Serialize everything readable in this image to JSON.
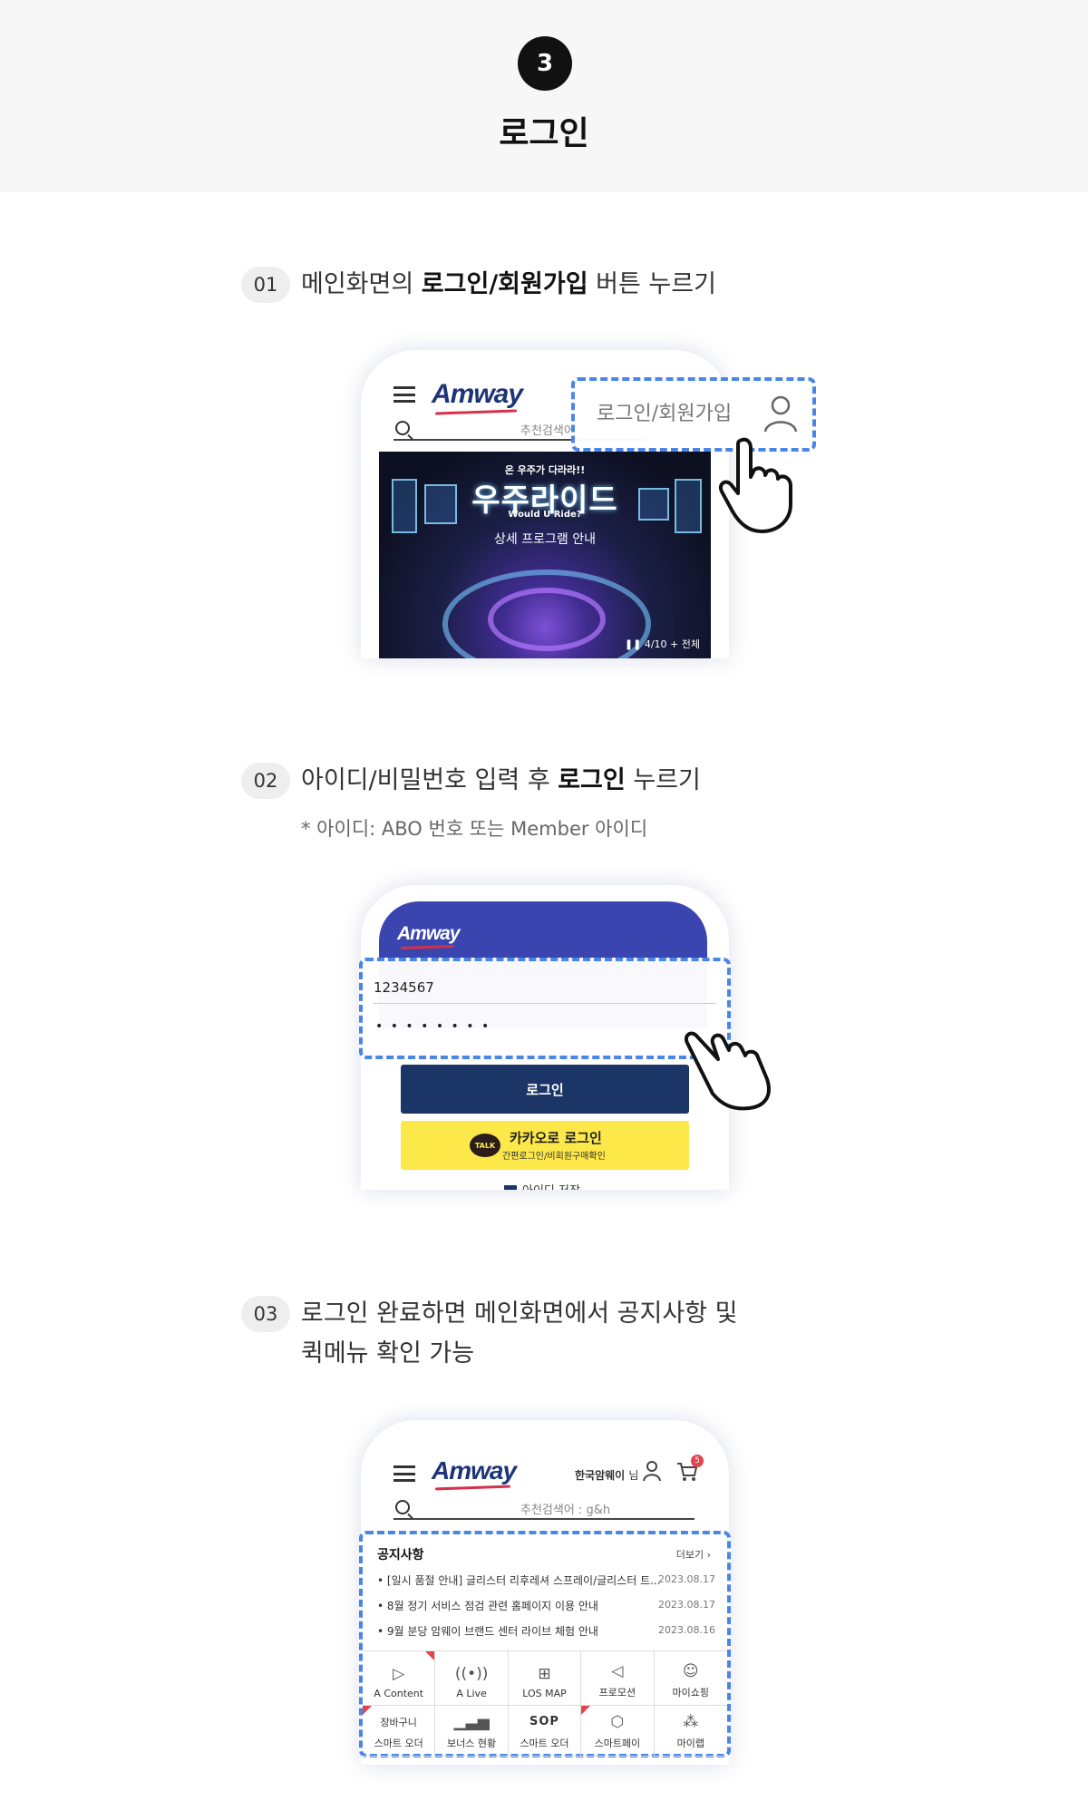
{
  "header": {
    "step_number": "3",
    "title": "로그인"
  },
  "steps": [
    {
      "num": "01",
      "text_before": "메인화면의 ",
      "text_bold": "로그인/회원가입",
      "text_after": " 버튼 누르기"
    },
    {
      "num": "02",
      "text_before": "아이디/비밀번호 입력 후 ",
      "text_bold": "로그인",
      "text_after": " 누르기",
      "note": "* 아이디: ABO 번호 또는 Member 아이디"
    },
    {
      "num": "03",
      "line1": "로그인 완료하면 메인화면에서 공지사항 및",
      "line2": "퀵메뉴 확인 가능"
    }
  ],
  "phone1": {
    "logo": "Amway",
    "search_placeholder": "추천검색어",
    "login_button": "로그인/회원가입",
    "banner": {
      "tag": "온 우주가 다라라!!",
      "title": "우주라이드",
      "subtitle": "Would U Ride?",
      "caption": "상세 프로그램 안내",
      "counter": "4/10",
      "all": "전체"
    }
  },
  "phone2": {
    "logo": "Amway",
    "id_value": "1234567",
    "password_mask": "• • • • • • • •",
    "login_button": "로그인",
    "kakao_icon": "TALK",
    "kakao_title": "카카오로 로그인",
    "kakao_sub": "간편로그인/비회원구매확인",
    "save_id": "아이디 저장"
  },
  "phone3": {
    "logo": "Amway",
    "user_name": "한국암웨이",
    "user_suffix": "님",
    "cart_count": "5",
    "search_placeholder": "추천검색어 : g&h",
    "notice": {
      "title": "공지사항",
      "more": "더보기",
      "items": [
        {
          "text": "[일시 품절 안내] 글리스터 리후레셔 스프레이/글리스터 트...",
          "date": "2023.08.17"
        },
        {
          "text": "8월 정기 서비스 점검 관련 홈페이지 이용 안내",
          "date": "2023.08.17"
        },
        {
          "text": "9월 분당 암웨이 브랜드 센터 라이브 체험 안내",
          "date": "2023.08.16"
        }
      ]
    },
    "quick_menu": [
      {
        "label": "A Content",
        "icon": "content-icon"
      },
      {
        "label": "A Live",
        "icon": "live-broadcast-icon"
      },
      {
        "label": "LOS MAP",
        "icon": "org-chart-icon"
      },
      {
        "label": "프로모션",
        "icon": "megaphone-icon"
      },
      {
        "label": "마이쇼핑",
        "icon": "my-shopping-icon"
      },
      {
        "top": "장바구니",
        "label": "스마트 오더",
        "icon": ""
      },
      {
        "label": "보너스 현황",
        "icon": "bar-chart-icon"
      },
      {
        "top": "SOP",
        "label": "스마트 오더",
        "icon": ""
      },
      {
        "label": "스마트페이",
        "icon": "smart-pay-icon"
      },
      {
        "label": "마이랩",
        "icon": "my-lab-icon"
      }
    ]
  },
  "colors": {
    "accent_dash": "#4a86e8",
    "navy": "#1c3567",
    "kakao": "#fde84a",
    "brand_red": "#d6304a"
  }
}
